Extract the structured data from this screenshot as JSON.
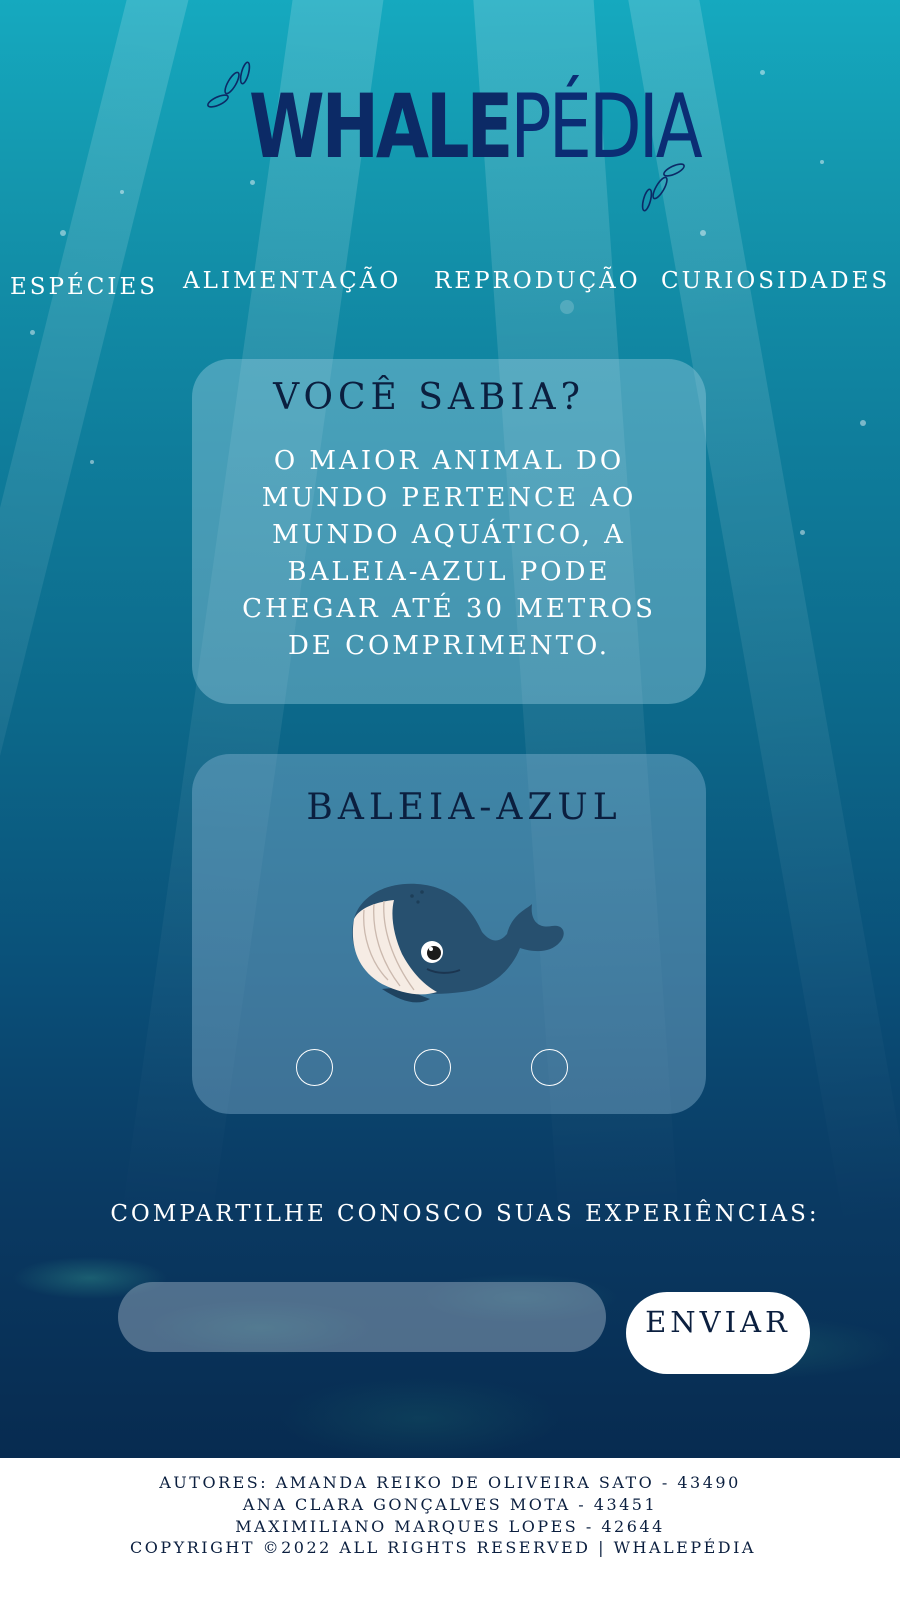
{
  "logo": {
    "part_bold": "WHALE",
    "part_light": "PÉDIA"
  },
  "nav": {
    "items": [
      "ESPÉCIES",
      "ALIMENTAÇÃO",
      "REPRODUÇÃO",
      "CURIOSIDADES"
    ]
  },
  "fact_card": {
    "title": "VOCÊ SABIA?",
    "text": "O MAIOR ANIMAL DO MUNDO PERTENCE AO MUNDO AQUÁTICO, A BALEIA-AZUL PODE CHEGAR ATÉ 30 METROS DE COMPRIMENTO."
  },
  "carousel": {
    "title": "BALEIA-AZUL",
    "image_icon": "whale-illustration",
    "dots_count": 3
  },
  "share": {
    "label": "COMPARTILHE CONOSCO SUAS EXPERIÊNCIAS:",
    "input_value": "",
    "send_label": "ENVIAR"
  },
  "footer": {
    "lines": [
      "AUTORES: AMANDA REIKO DE OLIVEIRA SATO - 43490",
      "ANA CLARA GONÇALVES MOTA - 43451",
      "MAXIMILIANO MARQUES LOPES - 42644",
      "COPYRIGHT ©2022 ALL RIGHTS RESERVED | WHALEPÉDIA"
    ]
  },
  "colors": {
    "title_navy": "#0b1f3f",
    "logo_blue": "#0c2a66",
    "card_fill": "rgba(150,205,225,0.42)"
  }
}
